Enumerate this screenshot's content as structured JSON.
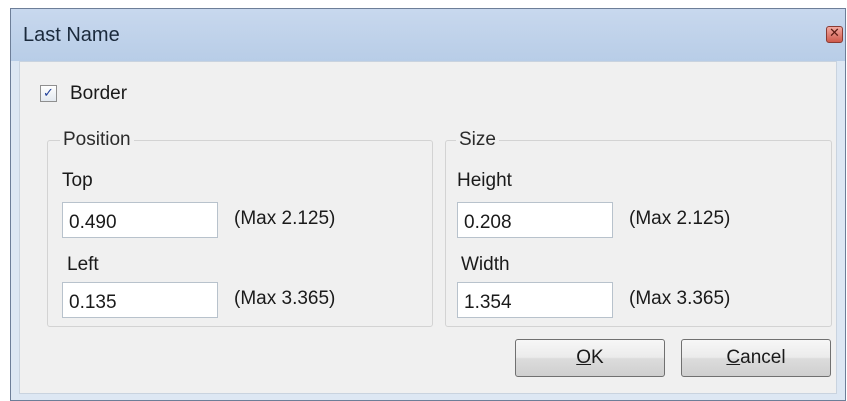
{
  "window": {
    "title": "Last Name"
  },
  "border_checkbox": {
    "label": "Border",
    "checked": true
  },
  "position": {
    "legend": "Position",
    "top": {
      "label": "Top",
      "value": "0.490",
      "max": "(Max 2.125)"
    },
    "left": {
      "label": "Left",
      "value": "0.135",
      "max": "(Max 3.365)"
    }
  },
  "size": {
    "legend": "Size",
    "height": {
      "label": "Height",
      "value": "0.208",
      "max": "(Max 2.125)"
    },
    "width": {
      "label": "Width",
      "value": "1.354",
      "max": "(Max 3.365)"
    }
  },
  "buttons": {
    "ok_mnemonic": "O",
    "ok_rest": "K",
    "cancel_mnemonic": "C",
    "cancel_rest": "ancel"
  },
  "icons": {
    "close": "close-icon",
    "check": "checkmark-icon"
  }
}
